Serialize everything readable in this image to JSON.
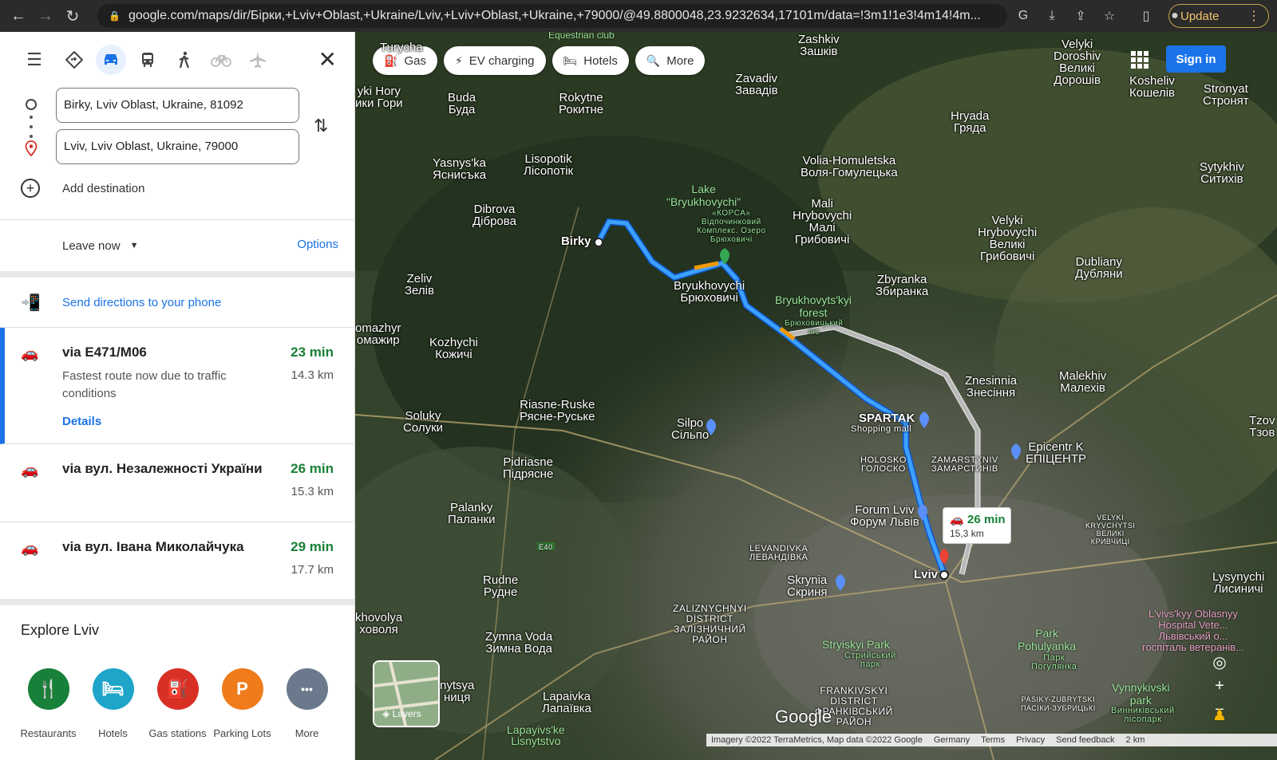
{
  "browser": {
    "url": "google.com/maps/dir/Бірки,+Lviv+Oblast,+Ukraine/Lviv,+Lviv+Oblast,+Ukraine,+79000/@49.8800048,23.9232634,17101m/data=!3m1!1e3!4m14!4m...",
    "update_label": "Update"
  },
  "directions": {
    "origin_value": "Birky, Lviv Oblast, Ukraine, 81092",
    "destination_value": "Lviv, Lviv Oblast, Ukraine, 79000",
    "add_destination": "Add destination",
    "leave_now": "Leave now",
    "options": "Options",
    "send_to_phone": "Send directions to your phone"
  },
  "routes": [
    {
      "name": "via E471/M06",
      "time": "23 min",
      "distance": "14.3 km",
      "description": "Fastest route now due to traffic conditions",
      "details": "Details"
    },
    {
      "name": "via вул. Незалежності України",
      "time": "26 min",
      "distance": "15.3 km"
    },
    {
      "name": "via вул. Івана Миколайчука",
      "time": "29 min",
      "distance": "17.7 km"
    }
  ],
  "explore": {
    "title": "Explore Lviv",
    "categories": [
      {
        "label": "Restaurants",
        "color": "#188038",
        "icon": "fork-knife-icon",
        "glyph": "🍴"
      },
      {
        "label": "Hotels",
        "color": "#1ea5c9",
        "icon": "bed-icon",
        "glyph": "🛏"
      },
      {
        "label": "Gas stations",
        "color": "#d93025",
        "icon": "gas-pump-icon",
        "glyph": "⛽"
      },
      {
        "label": "Parking Lots",
        "color": "#f07b1a",
        "icon": "parking-icon",
        "glyph": "P"
      },
      {
        "label": "More",
        "color": "#6a7a8c",
        "icon": "more-dots-icon",
        "glyph": "•••"
      }
    ]
  },
  "map": {
    "chips": [
      "Gas",
      "EV charging",
      "Hotels",
      "More"
    ],
    "sign_in": "Sign in",
    "route_box": {
      "time": "26 min",
      "distance": "15,3 km"
    },
    "layers_label": "Layers",
    "google": "Google",
    "footer": [
      "Imagery ©2022 TerraMetrics, Map data ©2022 Google",
      "Germany",
      "Terms",
      "Privacy",
      "Send feedback",
      "2 km"
    ],
    "labels": {
      "birky": "Birky",
      "bryukhovychi": "Bryukhovychi\nБрюховичі",
      "lake": "Lake\n\"Bryukhovychi\"",
      "lake_sub": "«КОРСА»\nВідпочинковий\nКомплекс. Озеро\nБрюховичі",
      "zashkiv": "Zashkiv\nЗашків",
      "zavadiv": "Zavadiv\nЗавадів",
      "velyki_dor": "Velyki\nDoroshiv\nВеликі\nДорошів",
      "kosheliv": "Kosheliv\nКошелів",
      "strontyn": "Stronyat\nСтронят",
      "buda": "Buda\nБуда",
      "rokytne": "Rokytne\nРокитне",
      "hryada": "Hryada\nГряда",
      "yasnyska": "Yasnys'ka\nЯснисъка",
      "lisopotik": "Lisopotik\nЛісопотік",
      "volia": "Volia-Homuletska\nВоля-Гомулецька",
      "sytykhiv": "Sytykhiv\nСитихів",
      "dibrova": "Dibrova\nДіброва",
      "mali_hryb": "Mali\nHrybovychi\nМалі\nГрибовичі",
      "velyki_hryb": "Velyki\nHrybovychi\nВеликі\nГрибовичі",
      "dubliany": "Dubliany\nДубляни",
      "zeliv": "Zeliv\nЗелів",
      "zbyranka": "Zbyranka\nЗбиранка",
      "forest": "Bryukhovyts'kyi\nforest",
      "forest_sub": "Брюховицький\nліс",
      "kozhychi": "Kozhychi\nКожичі",
      "zamazhyr": "omazhyr\nомажир",
      "znesinnia": "Znesinnia\nЗнесіння",
      "malekhiv": "Malekhiv\nМалехів",
      "riasne": "Riasne-Ruske\nРясне-Руське",
      "soluky": "Soluky\nСолуки",
      "silpo": "Silpo\nСільпо",
      "spartak": "SPARTAK",
      "spartak_sub": "Shopping mall",
      "epicentr": "Epicentr K\nЕПІЦЕНТР",
      "holosko": "HOLOSKO\nГОЛОСКО",
      "zamarstyniv": "ZAMARSTYNIV\nЗАМАРСТИНІВ",
      "pidriasne": "Pidriasne\nПідрясне",
      "palanky": "Palanky\nПаланки",
      "forum": "Forum Lviv\nФорум Львів",
      "velyki_kryv": "VELYKI\nKRYVCHYTSI\nВЕЛИКІ\nКРИВЧИЦІ",
      "levandivka": "LEVANDIVKA\nЛЕВАНДІВКА",
      "lviv": "Lviv",
      "lysynychi": "Lysynychi\nЛисиничі",
      "rudne": "Rudne\nРудне",
      "skrynia": "Skrynia\nСкриня",
      "zaliz": "ZALIZNYCHNYI\nDISTRICT\nЗАЛІЗНИЧНИЙ\nРАЙОН",
      "hospital": "L'vivs'kyy Oblasnyy\nHospital Vete...\nЛьвівський о...\nгоспіталь ветеранів...",
      "khovolya": "khovolya\nховоля",
      "zymna": "Zymna Voda\nЗимна Вода",
      "stryiskyi": "Stryiskyi Park",
      "stryiskyi_sub": "Стрийський\nпарк",
      "pohulyanka": "Park\nPohulyanka",
      "pohulyanka_sub": "Парк\nПогулянка",
      "vynnyk": "Vynnykivski\npark",
      "vynnyk_sub": "Винниківський\nлісопарк",
      "nytsya": "nytsya\nниця",
      "lapaivka": "Lapaivka\nЛапаївка",
      "frankivskyi": "FRANKIVSKYI\nDISTRICT\nФРАНКІВСЬКИЙ\nРАЙОН",
      "pasiky": "PASIKY-ZUBRYTSKI\nПАСІКИ-ЗУБРИЦЬКІ",
      "lapayivske": "Lapayivs'ke\nLisnytstvo",
      "horyhory": "yki Hory\nики Гори",
      "tzov": "Tzov\nТзов",
      "equestrian": "Equestrian club",
      "e40": "E40",
      "tureha": "Turycha"
    }
  }
}
